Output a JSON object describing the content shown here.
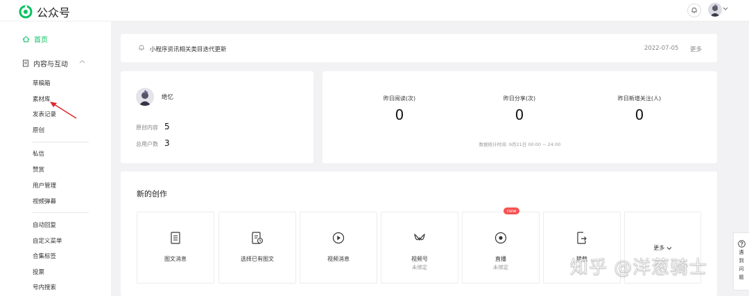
{
  "app": {
    "title": "公众号"
  },
  "sidebar": {
    "home": "首页",
    "group_content": "内容与互动",
    "items": [
      {
        "label": "草稿箱"
      },
      {
        "label": "素材库"
      },
      {
        "label": "发表记录"
      },
      {
        "label": "原创"
      },
      {
        "label": "私信"
      },
      {
        "label": "赞赏"
      },
      {
        "label": "用户管理"
      },
      {
        "label": "视频弹幕"
      },
      {
        "label": "自动回复"
      },
      {
        "label": "自定义菜单"
      },
      {
        "label": "合集标签"
      },
      {
        "label": "投票"
      },
      {
        "label": "号内搜索"
      }
    ]
  },
  "notice": {
    "text": "小程序资讯相关类目迭代更新",
    "date": "2022-07-05",
    "more": "更多"
  },
  "account": {
    "name": "绝忆",
    "original_label": "原创内容",
    "original_value": "5",
    "users_label": "总用户数",
    "users_value": "3"
  },
  "metrics": {
    "items": [
      {
        "label": "昨日阅读(次)",
        "value": "0"
      },
      {
        "label": "昨日分享(次)",
        "value": "0"
      },
      {
        "label": "昨日新增关注(人)",
        "value": "0"
      }
    ],
    "footnote": "数据统计时间: 9月21日 00:00 ~ 24:00"
  },
  "create": {
    "title": "新的创作",
    "badge": "new",
    "tiles": [
      {
        "label": "图文消息",
        "sub": "",
        "icon": "document-icon"
      },
      {
        "label": "选择已有图文",
        "sub": "",
        "icon": "document-select-icon"
      },
      {
        "label": "视频消息",
        "sub": "",
        "icon": "play-icon"
      },
      {
        "label": "视频号",
        "sub": "未绑定",
        "icon": "channels-icon"
      },
      {
        "label": "直播",
        "sub": "未绑定",
        "icon": "live-icon"
      },
      {
        "label": "转载",
        "sub": "",
        "icon": "repost-icon"
      },
      {
        "label": "更多",
        "sub": "",
        "icon": "chevron-down-icon"
      }
    ]
  },
  "help": {
    "chars": [
      "遇",
      "到",
      "问",
      "题"
    ]
  },
  "watermark": "知乎 @洋葱骑士",
  "colors": {
    "accent": "#07c160",
    "badge": "#fa5151"
  }
}
